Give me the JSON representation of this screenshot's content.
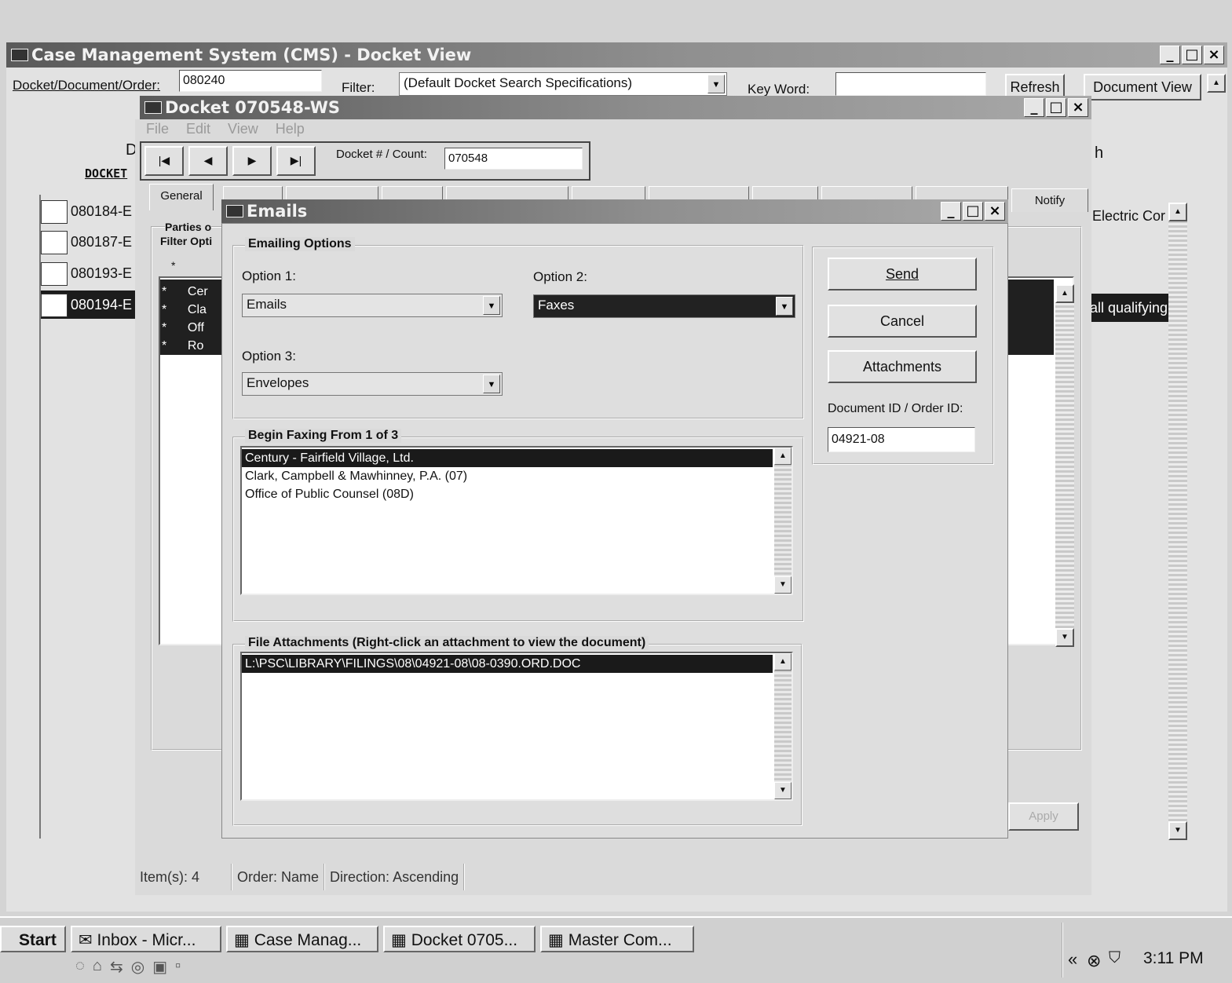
{
  "main_window": {
    "title": "Case Management System (CMS) - Docket View",
    "docket_label": "Docket/Document/Order:",
    "docket_value": "080240",
    "filter_label": "Filter:",
    "filter_value": "(Default Docket Search Specifications)",
    "keyword_label": "Key Word:",
    "keyword_value": "",
    "refresh_label": "Refresh",
    "document_view_label": "Document View",
    "header_partial_left": "D",
    "header_partial_right": "h",
    "docket_column_label": "DOCKET",
    "rows": [
      {
        "id": "080184-E",
        "desc": "Electric Cor"
      },
      {
        "id": "080187-E",
        "desc": ""
      },
      {
        "id": "080193-E",
        "desc": ""
      },
      {
        "id": "080194-E",
        "desc": "all qualifying"
      }
    ]
  },
  "docket_window": {
    "title": "Docket 070548-WS",
    "menu": [
      "File",
      "Edit",
      "View",
      "Help"
    ],
    "docket_count_label": "Docket # / Count:",
    "docket_count_value": "070548",
    "tabs": [
      "General",
      "Notify"
    ],
    "parties_label": "Parties o",
    "filter_options_label": "Filter Opti",
    "star": "*",
    "parties": [
      {
        "mark": "*",
        "name": "Cer"
      },
      {
        "mark": "*",
        "name": "Cla"
      },
      {
        "mark": "*",
        "name": "Off"
      },
      {
        "mark": "*",
        "name": "Ro"
      }
    ],
    "apply_label": "Apply",
    "status": {
      "items": "Item(s):  4",
      "order": "Order:  Name",
      "direction": "Direction:  Ascending"
    }
  },
  "emails_dialog": {
    "title": "Emails",
    "emailing_options_legend": "Emailing Options",
    "option1_label": "Option 1:",
    "option1_value": "Emails",
    "option2_label": "Option 2:",
    "option2_value": "Faxes",
    "option3_label": "Option 3:",
    "option3_value": "Envelopes",
    "send_label": "Send",
    "cancel_label": "Cancel",
    "attachments_label": "Attachments",
    "doc_id_label": "Document ID / Order ID:",
    "doc_id_value": "04921-08",
    "faxing_legend": "Begin Faxing From 1 of 3",
    "recipients": [
      "Century - Fairfield Village, Ltd.",
      "Clark, Campbell & Mawhinney, P.A. (07)",
      "Office of Public Counsel (08D)"
    ],
    "attachments_legend": "File Attachments (Right-click an attachment to view the document)",
    "attachment_files": [
      "L:\\PSC\\LIBRARY\\FILINGS\\08\\04921-08\\08-0390.ORD.DOC"
    ]
  },
  "taskbar": {
    "start_label": "Start",
    "tasks": [
      "Inbox - Micr...",
      "Case Manag...",
      "Docket 0705...",
      "Master Com..."
    ],
    "clock": "3:11 PM",
    "chevron": "«"
  },
  "colors": {
    "titlebar": "#6e6e6e",
    "selection": "#1a1a1a",
    "window_bg": "#dadada"
  }
}
